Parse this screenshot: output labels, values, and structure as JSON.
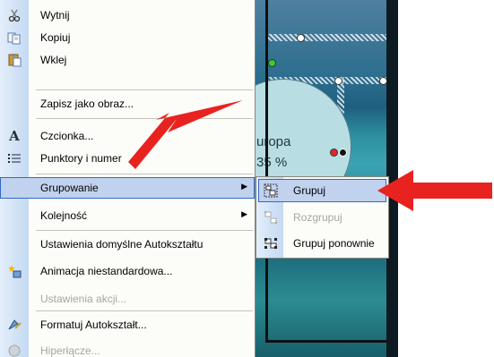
{
  "slide": {
    "text_line1": "uropa",
    "text_line2": "35 %"
  },
  "context_menu": {
    "items": [
      {
        "label": "Wytnij",
        "icon": "scissors-icon",
        "disabled": false
      },
      {
        "label": "Kopiuj",
        "icon": "copy-icon",
        "disabled": false
      },
      {
        "label": "Wklej",
        "icon": "paste-icon",
        "disabled": false
      },
      {
        "label": "Zapisz jako obraz...",
        "icon": "",
        "disabled": false
      },
      {
        "label": "Czcionka...",
        "icon": "font-icon",
        "disabled": false
      },
      {
        "label": "Punktory i numer",
        "icon": "bullets-icon",
        "disabled": false
      },
      {
        "label": "Grupowanie",
        "icon": "",
        "disabled": false,
        "highlighted": true,
        "has_submenu": true
      },
      {
        "label": "Kolejność",
        "icon": "",
        "disabled": false,
        "has_submenu": true
      },
      {
        "label": "Ustawienia domyślne Autokształtu",
        "icon": "",
        "disabled": false
      },
      {
        "label": "Animacja niestandardowa...",
        "icon": "animation-icon",
        "disabled": false
      },
      {
        "label": "Ustawienia akcji...",
        "icon": "",
        "disabled": true
      },
      {
        "label": "Formatuj Autokształt...",
        "icon": "format-shape-icon",
        "disabled": false
      },
      {
        "label": "Hiperłącze...",
        "icon": "hyperlink-icon",
        "disabled": true
      }
    ]
  },
  "submenu": {
    "items": [
      {
        "label": "Grupuj",
        "icon": "group-icon",
        "disabled": false,
        "highlighted": true
      },
      {
        "label": "Rozgrupuj",
        "icon": "ungroup-icon",
        "disabled": true
      },
      {
        "label": "Grupuj ponownie",
        "icon": "regroup-icon",
        "disabled": false
      }
    ]
  },
  "colors": {
    "highlight": "#c1d2ee",
    "highlight_border": "#316ac5",
    "arrow": "#e8231f",
    "disabled_text": "#a7a69d"
  }
}
